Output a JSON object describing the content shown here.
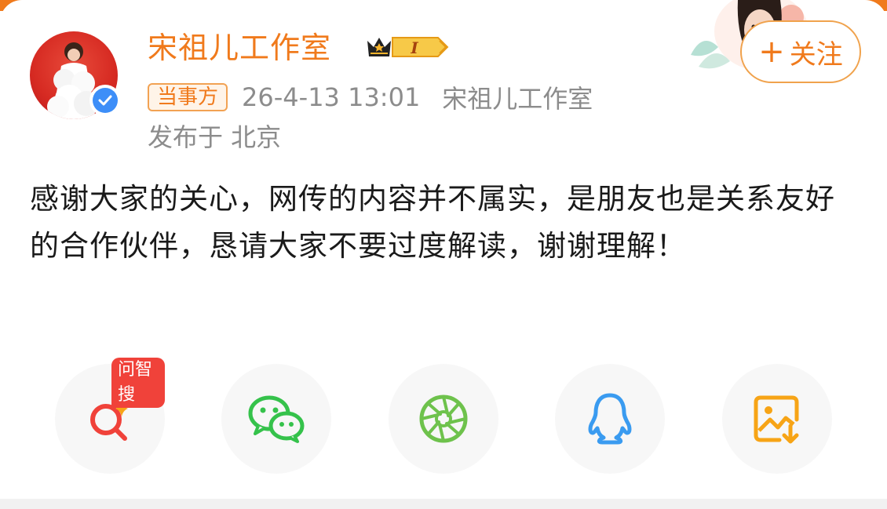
{
  "post": {
    "author": "宋祖儿工作室",
    "rank_label": "I",
    "badge": "当事方",
    "timestamp": "26-4-13 13:01",
    "source": "宋祖儿工作室",
    "location": "发布于 北京",
    "follow_label": "关注",
    "follow_plus": "+",
    "content": "感谢大家的关心，网传的内容并不属实，是朋友也是关系友好的合作伙伴，恳请大家不要过度解读，谢谢理解！"
  },
  "share": {
    "ai_tag": "问智搜",
    "items": [
      {
        "icon": "ai-search-icon"
      },
      {
        "icon": "wechat-icon"
      },
      {
        "icon": "moments-icon"
      },
      {
        "icon": "qq-icon"
      },
      {
        "icon": "save-image-icon"
      }
    ]
  },
  "colors": {
    "accent": "#f07a1c",
    "verified": "#3d8ef8",
    "wechat": "#35c24b",
    "moments": "#6ec24c",
    "qq": "#3a9bf0",
    "save": "#f7a416",
    "ai": "#f0423a"
  }
}
